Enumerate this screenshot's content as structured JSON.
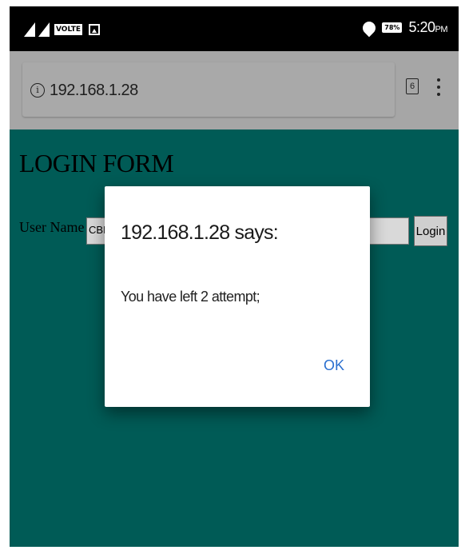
{
  "status_bar": {
    "network_badge": "VOLTE",
    "battery": "78%",
    "time": "5:20",
    "ampm": "PM",
    "icons": [
      "signal-icon",
      "signal-icon",
      "volte-icon",
      "gallery-notification-icon",
      "wifi-icon",
      "battery-icon"
    ]
  },
  "browser": {
    "url": "192.168.1.28",
    "tab_count": "6",
    "icons": [
      "info-icon",
      "tabs-icon",
      "overflow-menu-icon"
    ]
  },
  "page": {
    "title": "LOGIN FORM",
    "username_label": "User Name :",
    "username_value": "CBIT",
    "login_label": "Login",
    "colors": {
      "background": "#005b56"
    }
  },
  "dialog": {
    "title": "192.168.1.28 says:",
    "message": "You have left 2 attempt;",
    "ok_label": "OK",
    "colors": {
      "ok": "#2a6fcf"
    }
  }
}
